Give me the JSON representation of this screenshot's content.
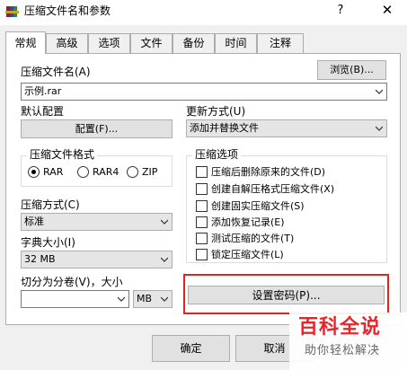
{
  "window": {
    "title": "压缩文件名和参数",
    "help_glyph": "?",
    "close_glyph": "✕"
  },
  "tabs": [
    "常规",
    "高级",
    "选项",
    "文件",
    "备份",
    "时间",
    "注释"
  ],
  "archive_name": {
    "label": "压缩文件名(A)",
    "value": "示例.rar",
    "browse_button": "浏览(B)..."
  },
  "default_profile": {
    "label": "默认配置",
    "button": "配置(F)..."
  },
  "update_mode": {
    "label": "更新方式(U)",
    "value": "添加并替换文件"
  },
  "archive_format": {
    "title": "压缩文件格式",
    "options": [
      "RAR",
      "RAR4",
      "ZIP"
    ],
    "selected": "RAR"
  },
  "compression_method": {
    "label": "压缩方式(C)",
    "value": "标准"
  },
  "dictionary_size": {
    "label": "字典大小(I)",
    "value": "32 MB"
  },
  "split_volumes": {
    "label": "切分为分卷(V)，大小",
    "value": "",
    "unit": "MB"
  },
  "archive_options": {
    "title": "压缩选项",
    "items": [
      {
        "label": "压缩后删除原来的文件(D)",
        "checked": false
      },
      {
        "label": "创建自解压格式压缩文件(X)",
        "checked": false
      },
      {
        "label": "创建固实压缩文件(S)",
        "checked": false
      },
      {
        "label": "添加恢复记录(E)",
        "checked": false
      },
      {
        "label": "测试压缩的文件(T)",
        "checked": false
      },
      {
        "label": "锁定压缩文件(L)",
        "checked": false
      }
    ]
  },
  "set_password_button": "设置密码(P)...",
  "footer": {
    "ok": "确定",
    "cancel": "取消"
  },
  "watermark": {
    "title": "百科全说",
    "subtitle": "助你轻松解决"
  },
  "colors": {
    "highlight_border": "#e1251b",
    "watermark_red": "#e7262b"
  },
  "icons": {
    "app": "winrar-books-icon",
    "dropdown": "chevron-down-icon"
  }
}
